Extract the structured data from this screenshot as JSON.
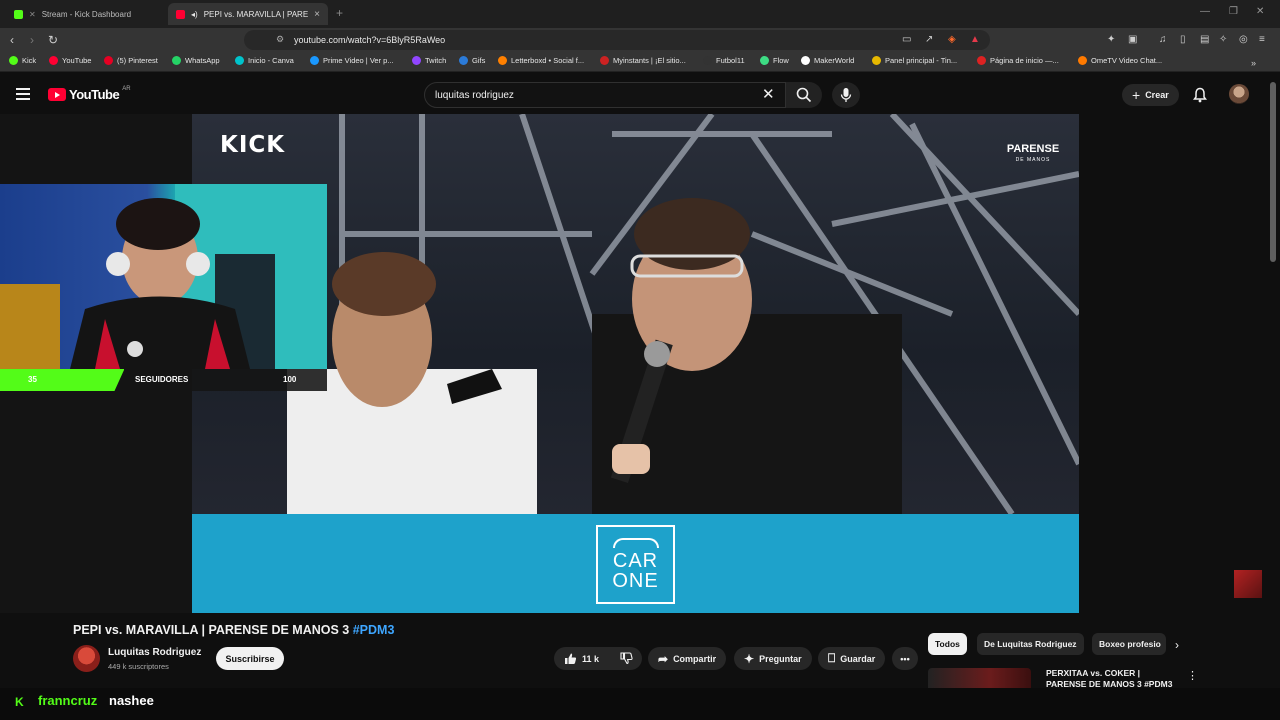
{
  "browser": {
    "tabs": [
      {
        "label": "Stream - Kick Dashboard",
        "color": "#53fc18"
      },
      {
        "label": "PEPI vs. MARAVILLA | PARENS",
        "color": "#ff0033"
      }
    ],
    "url": "youtube.com/watch?v=6BlyR5RaWeo",
    "bookmarks": [
      {
        "label": "Kick",
        "color": "#53fc18"
      },
      {
        "label": "YouTube",
        "color": "#ff0033"
      },
      {
        "label": "(5) Pinterest",
        "color": "#e60023"
      },
      {
        "label": "WhatsApp",
        "color": "#25d366"
      },
      {
        "label": "Inicio - Canva",
        "color": "#00c4cc"
      },
      {
        "label": "Prime Video | Ver p...",
        "color": "#1a98ff"
      },
      {
        "label": "Twitch",
        "color": "#9146ff"
      },
      {
        "label": "Gifs",
        "color": "#2b7bd9"
      },
      {
        "label": "Letterboxd • Social f...",
        "color": "#ff8000"
      },
      {
        "label": "Myinstants | ¡El sitio...",
        "color": "#c22"
      },
      {
        "label": "Futbol11",
        "color": "#333333"
      },
      {
        "label": "Flow",
        "color": "#3ddc84"
      },
      {
        "label": "MakerWorld",
        "color": "#ffffff"
      },
      {
        "label": "Panel principal - Tin...",
        "color": "#e6b800"
      },
      {
        "label": "Página de inicio —...",
        "color": "#d22"
      },
      {
        "label": "OmeTV Video Chat...",
        "color": "#ff7a00"
      }
    ]
  },
  "youtube": {
    "logo_text": "YouTube",
    "country_code": "AR",
    "search_value": "luquitas rodriguez",
    "create_label": "Crear"
  },
  "video": {
    "kick_watermark": "KICK",
    "parense_line1": "PARENSE",
    "parense_line2": "DE MANOS",
    "sponsor_line1": "CAR",
    "sponsor_line2": "ONE",
    "title": "PEPI vs. MARAVILLA | PARENSE DE MANOS 3",
    "hashtag": "#PDM3"
  },
  "stream_overlay": {
    "followers_current": "35",
    "followers_label": "SEGUIDORES",
    "followers_goal": "100",
    "progress": 0.35,
    "accent": "#53fc18"
  },
  "channel": {
    "name": "Luquitas Rodriguez",
    "subscribers": "449 k suscriptores",
    "subscribe_label": "Suscribirse"
  },
  "actions": {
    "likes": "11 k",
    "share": "Compartir",
    "ask": "Preguntar",
    "save": "Guardar"
  },
  "chips": [
    "Todos",
    "De Luquitas Rodriguez",
    "Boxeo profesio"
  ],
  "recommendation": {
    "title": "PERXITAA vs. COKER | PARENSE DE MANOS 3 #PDM3"
  },
  "chat": {
    "username": "franncruz",
    "message": "nashee"
  }
}
